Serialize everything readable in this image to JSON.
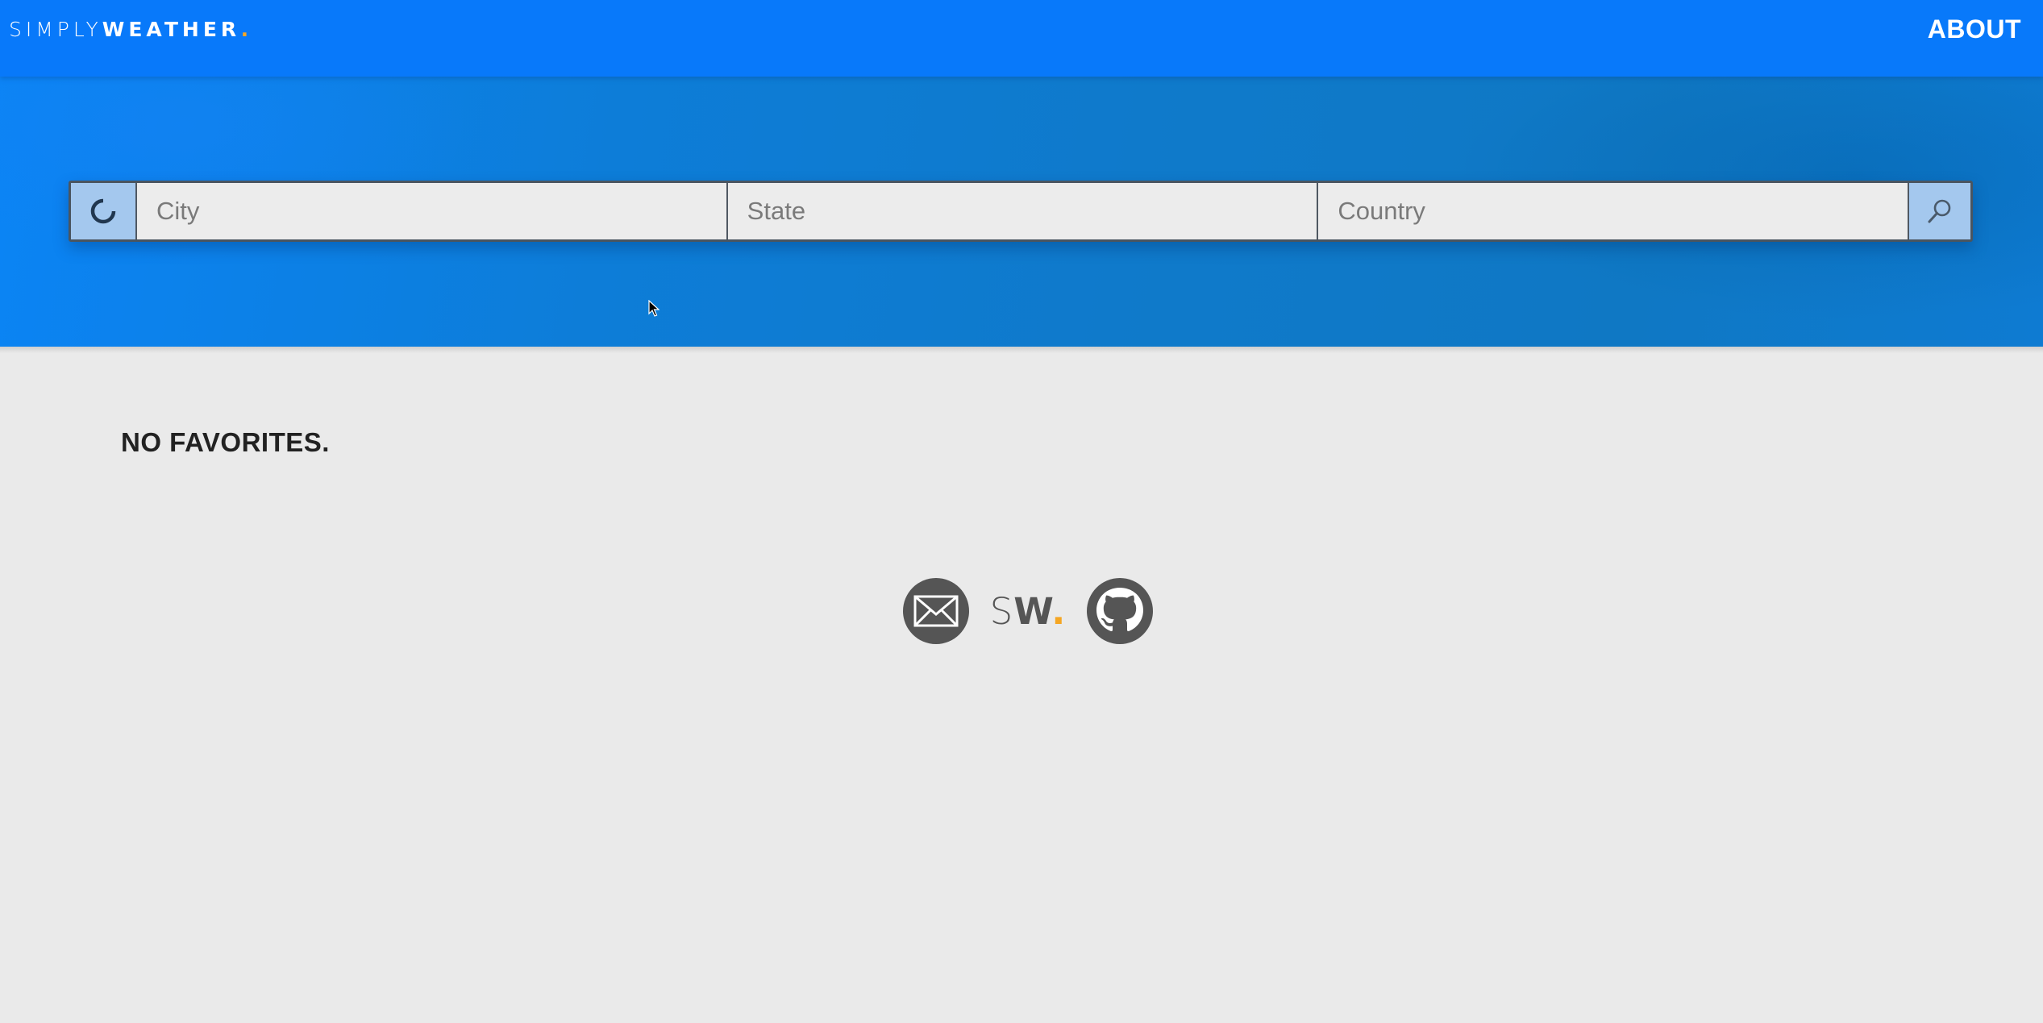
{
  "header": {
    "logo": {
      "thin": "SIMPLY",
      "bold": "WEATHER",
      "dot": "."
    },
    "about_label": "ABOUT"
  },
  "search": {
    "city_placeholder": "City",
    "state_placeholder": "State",
    "country_placeholder": "Country",
    "city_value": "",
    "state_value": "",
    "country_value": "",
    "location_icon": "refresh-spinner-icon",
    "search_icon": "search-icon"
  },
  "main": {
    "favorites_empty_text": "NO FAVORITES."
  },
  "footer": {
    "email_icon": "envelope-icon",
    "logo": {
      "thin": "S",
      "bold": "W",
      "dot": "."
    },
    "github_icon": "github-icon"
  },
  "colors": {
    "brand_blue": "#0879fa",
    "accent_orange": "#f5a623",
    "button_light_blue": "#a4c8ee",
    "footer_gray": "#555555"
  }
}
